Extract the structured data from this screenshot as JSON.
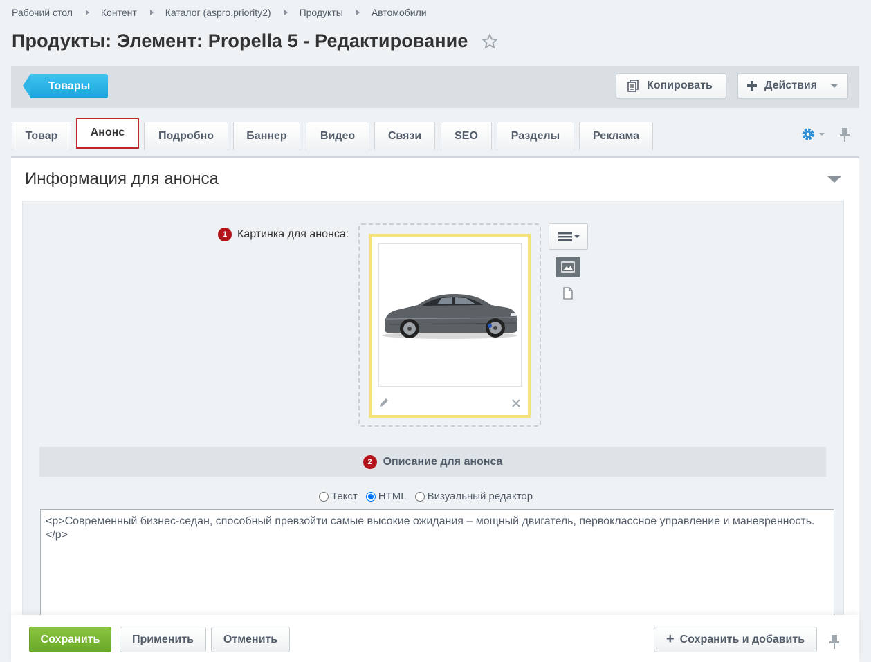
{
  "breadcrumb": [
    "Рабочий стол",
    "Контент",
    "Каталог (aspro.priority2)",
    "Продукты",
    "Автомобили"
  ],
  "page_title": "Продукты: Элемент: Propella 5 - Редактирование",
  "toolbar": {
    "back_label": "Товары",
    "copy_label": "Копировать",
    "actions_label": "Действия"
  },
  "tabs": [
    {
      "label": "Товар",
      "active": false
    },
    {
      "label": "Анонс",
      "active": true
    },
    {
      "label": "Подробно",
      "active": false
    },
    {
      "label": "Баннер",
      "active": false
    },
    {
      "label": "Видео",
      "active": false
    },
    {
      "label": "Связи",
      "active": false
    },
    {
      "label": "SEO",
      "active": false
    },
    {
      "label": "Разделы",
      "active": false
    },
    {
      "label": "Реклама",
      "active": false
    }
  ],
  "section": {
    "title": "Информация для анонса"
  },
  "picture_field": {
    "badge": "1",
    "label": "Картинка для анонса:"
  },
  "description_field": {
    "badge": "2",
    "label": "Описание для анонса",
    "modes": [
      {
        "label": "Текст",
        "checked": false
      },
      {
        "label": "HTML",
        "checked": true
      },
      {
        "label": "Визуальный редактор",
        "checked": false
      }
    ],
    "value": "<p>Современный бизнес-седан, способный превзойти самые высокие ожидания – мощный двигатель, первоклассное управление и маневренность.\n</p>"
  },
  "footer": {
    "save_label": "Сохранить",
    "apply_label": "Применить",
    "cancel_label": "Отменить",
    "save_add_label": "Сохранить и добавить"
  },
  "colors": {
    "accent_blue": "#1aa5d9",
    "save_green": "#7ab735",
    "badge_red": "#b3141b",
    "active_tab_border": "#c1252a"
  }
}
